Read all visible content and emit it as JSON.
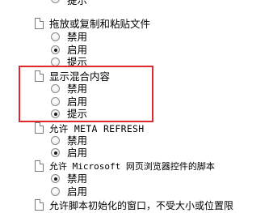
{
  "options": {
    "disable": "禁用",
    "enable": "启用",
    "prompt": "提示"
  },
  "settings": [
    {
      "title": "拖放或复制和粘贴文件",
      "selected": "enable"
    },
    {
      "title": "显示混合内容",
      "selected": "prompt"
    },
    {
      "title": "允许 META REFRESH",
      "selected": "enable"
    },
    {
      "title": "允许 Microsoft 网页浏览器控件的脚本",
      "selected": "disable"
    },
    {
      "title": "允许脚本初始化的窗口，不受大小或位置限"
    }
  ]
}
